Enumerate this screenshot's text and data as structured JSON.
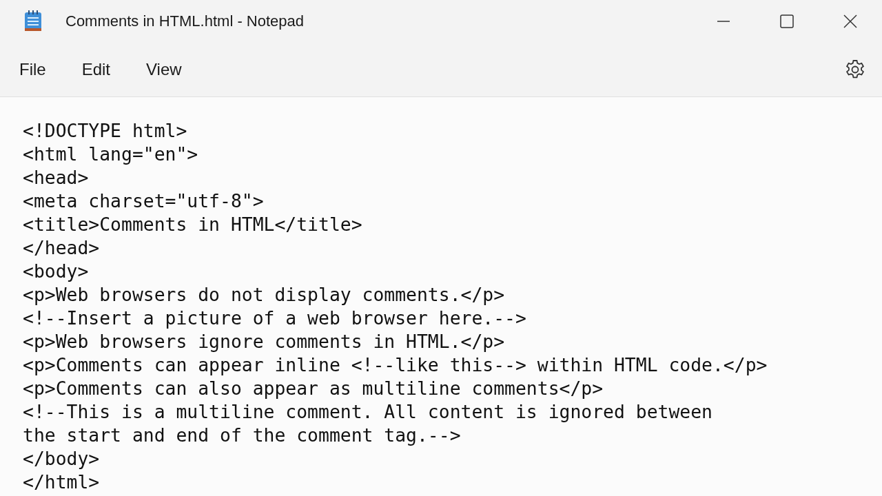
{
  "window": {
    "title": "Comments in HTML.html - Notepad"
  },
  "menu": [
    {
      "label": "File"
    },
    {
      "label": "Edit"
    },
    {
      "label": "View"
    }
  ],
  "editor": {
    "lines": [
      "<!DOCTYPE html>",
      "<html lang=\"en\">",
      "<head>",
      "<meta charset=\"utf-8\">",
      "<title>Comments in HTML</title>",
      "</head>",
      "<body>",
      "<p>Web browsers do not display comments.</p>",
      "<!--Insert a picture of a web browser here.-->",
      "<p>Web browsers ignore comments in HTML.</p>",
      "<p>Comments can appear inline <!--like this--> within HTML code.</p>",
      "<p>Comments can also appear as multiline comments</p>",
      "<!--This is a multiline comment. All content is ignored between",
      "the start and end of the comment tag.-->",
      "</body>",
      "</html>"
    ]
  }
}
